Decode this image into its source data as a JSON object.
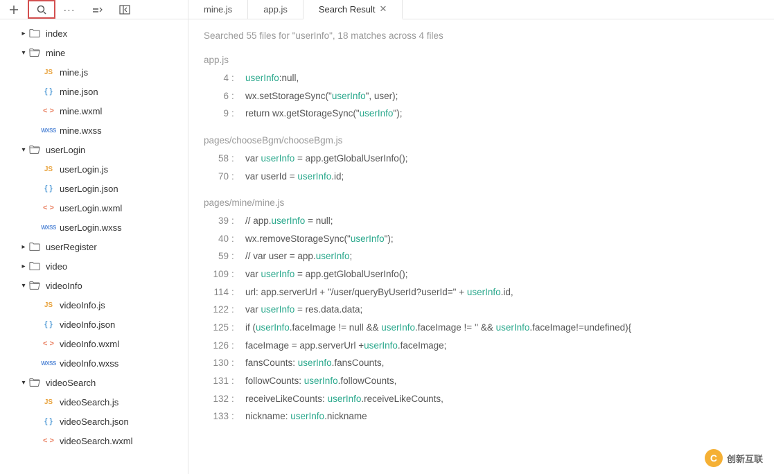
{
  "toolbar": {
    "buttons": [
      "plus",
      "search",
      "ellipsis",
      "nav",
      "panel-toggle"
    ]
  },
  "tree": [
    {
      "type": "folder",
      "name": "index",
      "open": false,
      "indent": 0
    },
    {
      "type": "folder",
      "name": "mine",
      "open": true,
      "indent": 0,
      "children": [
        {
          "type": "file",
          "name": "mine.js",
          "icon": "js"
        },
        {
          "type": "file",
          "name": "mine.json",
          "icon": "json"
        },
        {
          "type": "file",
          "name": "mine.wxml",
          "icon": "wxml"
        },
        {
          "type": "file",
          "name": "mine.wxss",
          "icon": "wxss"
        }
      ]
    },
    {
      "type": "folder",
      "name": "userLogin",
      "open": true,
      "indent": 0,
      "children": [
        {
          "type": "file",
          "name": "userLogin.js",
          "icon": "js"
        },
        {
          "type": "file",
          "name": "userLogin.json",
          "icon": "json"
        },
        {
          "type": "file",
          "name": "userLogin.wxml",
          "icon": "wxml"
        },
        {
          "type": "file",
          "name": "userLogin.wxss",
          "icon": "wxss"
        }
      ]
    },
    {
      "type": "folder",
      "name": "userRegister",
      "open": false,
      "indent": 0
    },
    {
      "type": "folder",
      "name": "video",
      "open": false,
      "indent": 0
    },
    {
      "type": "folder",
      "name": "videoInfo",
      "open": true,
      "indent": 0,
      "children": [
        {
          "type": "file",
          "name": "videoInfo.js",
          "icon": "js"
        },
        {
          "type": "file",
          "name": "videoInfo.json",
          "icon": "json"
        },
        {
          "type": "file",
          "name": "videoInfo.wxml",
          "icon": "wxml"
        },
        {
          "type": "file",
          "name": "videoInfo.wxss",
          "icon": "wxss"
        }
      ]
    },
    {
      "type": "folder",
      "name": "videoSearch",
      "open": true,
      "indent": 0,
      "children": [
        {
          "type": "file",
          "name": "videoSearch.js",
          "icon": "js"
        },
        {
          "type": "file",
          "name": "videoSearch.json",
          "icon": "json"
        },
        {
          "type": "file",
          "name": "videoSearch.wxml",
          "icon": "wxml"
        }
      ]
    }
  ],
  "tabs": [
    {
      "label": "mine.js",
      "active": false,
      "closable": false
    },
    {
      "label": "app.js",
      "active": false,
      "closable": false
    },
    {
      "label": "Search Result",
      "active": true,
      "closable": true
    }
  ],
  "search": {
    "summary": "Searched 55 files for \"userInfo\", 18 matches across 4 files",
    "groups": [
      {
        "file": "app.js",
        "lines": [
          {
            "n": "4",
            "segs": [
              [
                "",
                "userInfo"
              ],
              [
                ":null,",
                ""
              ]
            ]
          },
          {
            "n": "6",
            "segs": [
              [
                "wx.setStorageSync(\"",
                ""
              ],
              [
                "",
                "userInfo"
              ],
              [
                "\", user);",
                ""
              ]
            ]
          },
          {
            "n": "9",
            "segs": [
              [
                "return wx.getStorageSync(\"",
                ""
              ],
              [
                "",
                "userInfo"
              ],
              [
                "\");",
                ""
              ]
            ]
          }
        ]
      },
      {
        "file": "pages/chooseBgm/chooseBgm.js",
        "lines": [
          {
            "n": "58",
            "segs": [
              [
                "var ",
                ""
              ],
              [
                "",
                "userInfo"
              ],
              [
                " = app.getGlobalUserInfo();",
                ""
              ]
            ]
          },
          {
            "n": "70",
            "segs": [
              [
                "var userId = ",
                ""
              ],
              [
                "",
                "userInfo"
              ],
              [
                ".id;",
                ""
              ]
            ]
          }
        ]
      },
      {
        "file": "pages/mine/mine.js",
        "lines": [
          {
            "n": "39",
            "segs": [
              [
                "// app.",
                ""
              ],
              [
                "",
                "userInfo"
              ],
              [
                " = null;",
                ""
              ]
            ]
          },
          {
            "n": "40",
            "segs": [
              [
                "wx.removeStorageSync(\"",
                ""
              ],
              [
                "",
                "userInfo"
              ],
              [
                "\");",
                ""
              ]
            ]
          },
          {
            "n": "59",
            "segs": [
              [
                "// var user = app.",
                ""
              ],
              [
                "",
                "userInfo"
              ],
              [
                ";",
                ""
              ]
            ]
          },
          {
            "n": "109",
            "segs": [
              [
                "var ",
                ""
              ],
              [
                "",
                "userInfo"
              ],
              [
                " = app.getGlobalUserInfo();",
                ""
              ]
            ]
          },
          {
            "n": "114",
            "segs": [
              [
                "url: app.serverUrl + \"/user/queryByUserId?userId=\" + ",
                ""
              ],
              [
                "",
                "userInfo"
              ],
              [
                ".id,",
                ""
              ]
            ]
          },
          {
            "n": "122",
            "segs": [
              [
                "var ",
                ""
              ],
              [
                "",
                "userInfo"
              ],
              [
                " = res.data.data;",
                ""
              ]
            ]
          },
          {
            "n": "125",
            "segs": [
              [
                "if (",
                ""
              ],
              [
                "",
                "userInfo"
              ],
              [
                ".faceImage != null && ",
                ""
              ],
              [
                "",
                "userInfo"
              ],
              [
                ".faceImage != '' && ",
                ""
              ],
              [
                "",
                "userInfo"
              ],
              [
                ".faceImage!=undefined){",
                ""
              ]
            ]
          },
          {
            "n": "126",
            "segs": [
              [
                "faceImage = app.serverUrl +",
                ""
              ],
              [
                "",
                "userInfo"
              ],
              [
                ".faceImage;",
                ""
              ]
            ]
          },
          {
            "n": "130",
            "segs": [
              [
                "fansCounts: ",
                ""
              ],
              [
                "",
                "userInfo"
              ],
              [
                ".fansCounts,",
                ""
              ]
            ]
          },
          {
            "n": "131",
            "segs": [
              [
                "followCounts: ",
                ""
              ],
              [
                "",
                "userInfo"
              ],
              [
                ".followCounts,",
                ""
              ]
            ]
          },
          {
            "n": "132",
            "segs": [
              [
                "receiveLikeCounts: ",
                ""
              ],
              [
                "",
                "userInfo"
              ],
              [
                ".receiveLikeCounts,",
                ""
              ]
            ]
          },
          {
            "n": "133",
            "segs": [
              [
                "nickname: ",
                ""
              ],
              [
                "",
                "userInfo"
              ],
              [
                ".nickname",
                ""
              ]
            ]
          }
        ]
      }
    ]
  },
  "watermark": {
    "text": "创新互联"
  }
}
